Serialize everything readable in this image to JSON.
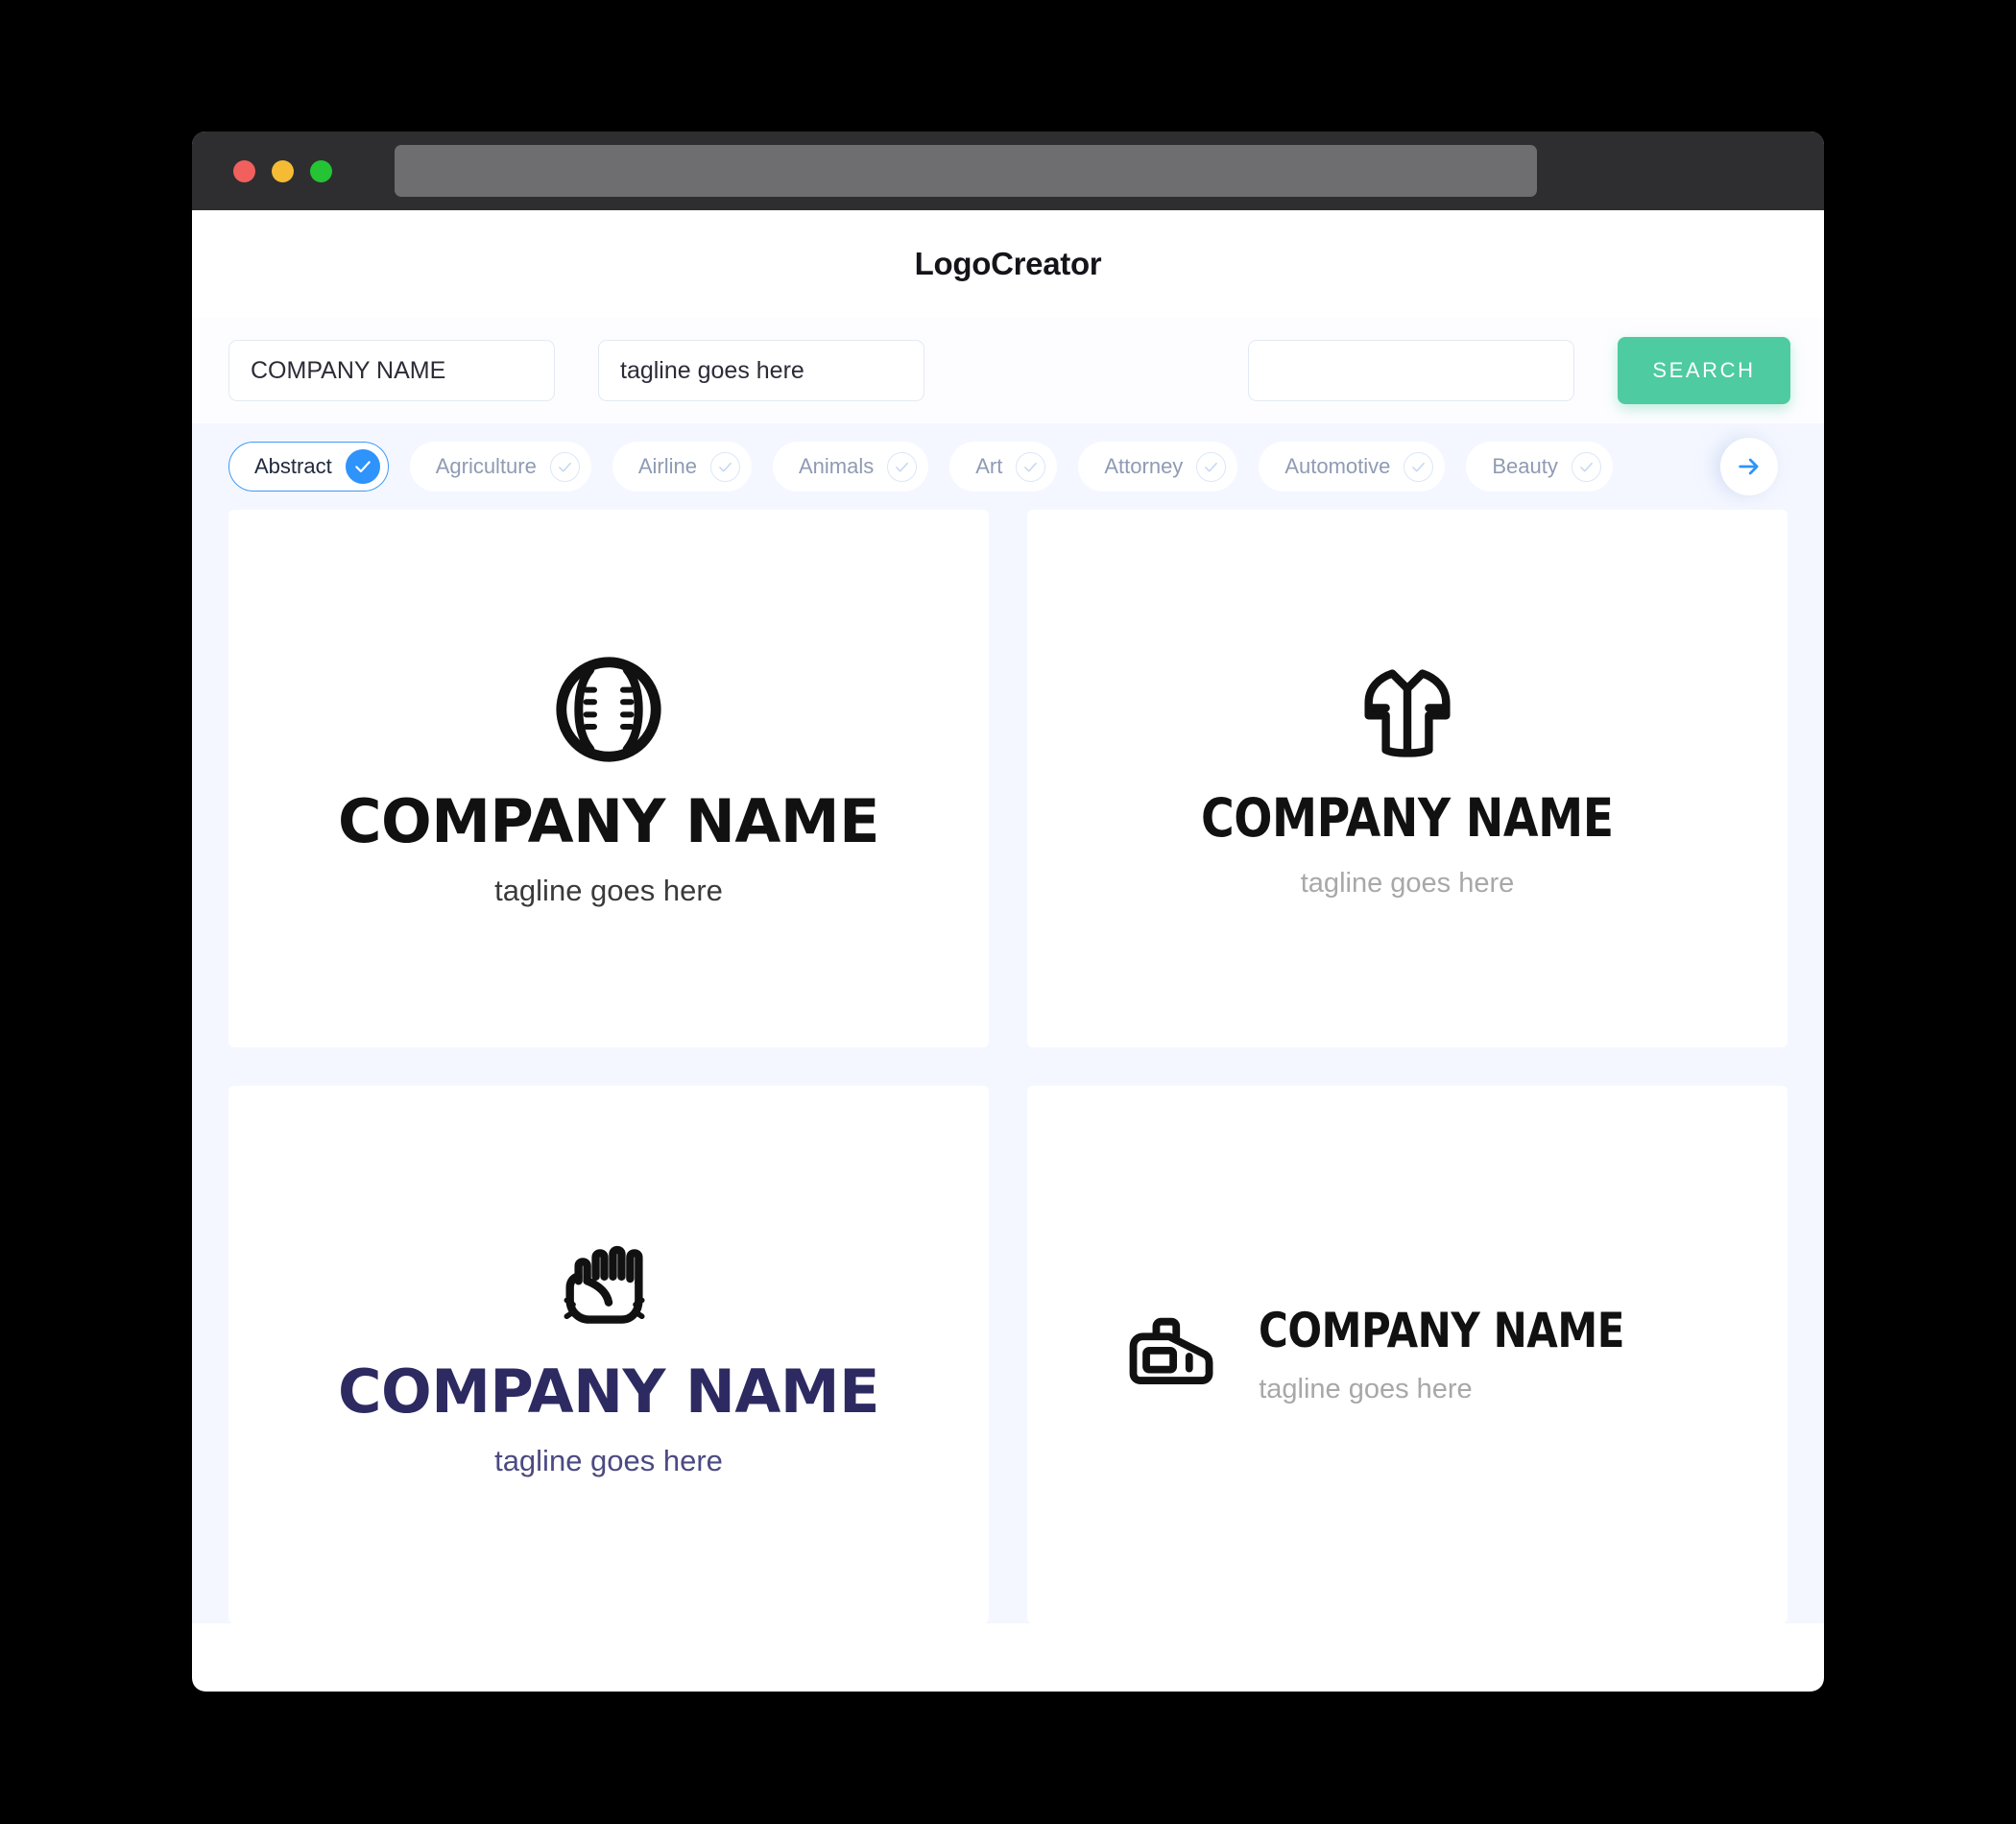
{
  "window": {
    "traffic_lights": [
      "close",
      "minimize",
      "maximize"
    ],
    "url_value": ""
  },
  "header": {
    "title": "LogoCreator"
  },
  "search": {
    "company_value": "COMPANY NAME",
    "company_placeholder": "COMPANY NAME",
    "tagline_value": "tagline goes here",
    "tagline_placeholder": "tagline goes here",
    "keyword_value": "",
    "keyword_placeholder": "",
    "button_label": "SEARCH"
  },
  "categories": {
    "next_label": "next",
    "items": [
      {
        "label": "Abstract",
        "selected": true
      },
      {
        "label": "Agriculture",
        "selected": false
      },
      {
        "label": "Airline",
        "selected": false
      },
      {
        "label": "Animals",
        "selected": false
      },
      {
        "label": "Art",
        "selected": false
      },
      {
        "label": "Attorney",
        "selected": false
      },
      {
        "label": "Automotive",
        "selected": false
      },
      {
        "label": "Beauty",
        "selected": false
      }
    ]
  },
  "results": [
    {
      "icon": "baseball-icon",
      "layout": "stacked",
      "name": "COMPANY NAME",
      "tagline": "tagline goes here",
      "name_color": "#111111",
      "tagline_color": "#3a3a3a"
    },
    {
      "icon": "baseball-jersey-icon",
      "layout": "stacked",
      "name": "COMPANY NAME",
      "tagline": "tagline goes here",
      "name_color": "#111111",
      "tagline_color": "#a8a8a8"
    },
    {
      "icon": "baseball-glove-icon",
      "layout": "stacked",
      "name": "COMPANY NAME",
      "tagline": "tagline goes here",
      "name_color": "#2d2a62",
      "tagline_color": "#4b4a82"
    },
    {
      "icon": "sports-bag-icon",
      "layout": "inline",
      "name": "COMPANY NAME",
      "tagline": "tagline goes here",
      "name_color": "#111111",
      "tagline_color": "#a8a8a8"
    }
  ],
  "colors": {
    "accent_green": "#4ecba0",
    "accent_blue": "#2e93fb",
    "page_bg": "#f4f7ff",
    "titlebar": "#2e2e31"
  }
}
